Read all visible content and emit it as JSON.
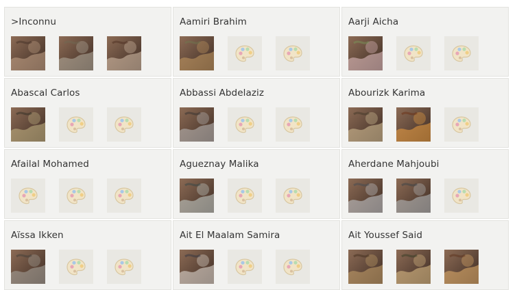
{
  "cards": [
    {
      "name": ">Inconnu",
      "thumbs": [
        {
          "kind": "image",
          "icon": "portrait-painting",
          "colors": [
            "#8c6b55",
            "#c7a58a",
            "#3d2c24"
          ]
        },
        {
          "kind": "image",
          "icon": "flowers-painting",
          "colors": [
            "#3b3a35",
            "#b6b1a3",
            "#6f6a55"
          ]
        },
        {
          "kind": "image",
          "icon": "portrait-painting",
          "colors": [
            "#7c4d32",
            "#d9c3ad",
            "#4a2a1d"
          ]
        }
      ]
    },
    {
      "name": "Aamiri Brahim",
      "thumbs": [
        {
          "kind": "image",
          "icon": "landscape-painting",
          "colors": [
            "#9fb3c7",
            "#c59a62",
            "#6f7b50"
          ]
        },
        {
          "kind": "placeholder",
          "icon": "palette-icon"
        },
        {
          "kind": "placeholder",
          "icon": "palette-icon"
        }
      ]
    },
    {
      "name": "Aarji Aicha",
      "thumbs": [
        {
          "kind": "image",
          "icon": "garden-painting",
          "colors": [
            "#2f5b2e",
            "#e8c4c9",
            "#7a9b5a"
          ]
        },
        {
          "kind": "placeholder",
          "icon": "palette-icon"
        },
        {
          "kind": "placeholder",
          "icon": "palette-icon"
        }
      ]
    },
    {
      "name": "Abascal Carlos",
      "thumbs": [
        {
          "kind": "image",
          "icon": "portrait-painting",
          "colors": [
            "#5c5a48",
            "#c7b887",
            "#2b2b22"
          ]
        },
        {
          "kind": "placeholder",
          "icon": "palette-icon"
        },
        {
          "kind": "placeholder",
          "icon": "palette-icon"
        }
      ]
    },
    {
      "name": "Abbassi Abdelaziz",
      "thumbs": [
        {
          "kind": "image",
          "icon": "abstract-painting",
          "colors": [
            "#6f6f6f",
            "#bdbdbd",
            "#2f2f2f"
          ]
        },
        {
          "kind": "placeholder",
          "icon": "palette-icon"
        },
        {
          "kind": "placeholder",
          "icon": "palette-icon"
        }
      ]
    },
    {
      "name": "Abourizk Karima",
      "thumbs": [
        {
          "kind": "image",
          "icon": "horse-painting",
          "colors": [
            "#7a6a4a",
            "#d8c59b",
            "#3f3525"
          ]
        },
        {
          "kind": "image",
          "icon": "horse-painting",
          "colors": [
            "#c4611e",
            "#f0a341",
            "#6b2d10"
          ]
        },
        {
          "kind": "placeholder",
          "icon": "palette-icon"
        }
      ]
    },
    {
      "name": "Afailal Mohamed",
      "thumbs": [
        {
          "kind": "placeholder",
          "icon": "palette-icon"
        },
        {
          "kind": "placeholder",
          "icon": "palette-icon"
        },
        {
          "kind": "placeholder",
          "icon": "palette-icon"
        }
      ]
    },
    {
      "name": "Agueznay Malika",
      "thumbs": [
        {
          "kind": "image",
          "icon": "calligraphy-painting",
          "colors": [
            "#5f7d7f",
            "#c9d3cf",
            "#2f4446"
          ]
        },
        {
          "kind": "placeholder",
          "icon": "palette-icon"
        },
        {
          "kind": "placeholder",
          "icon": "palette-icon"
        }
      ]
    },
    {
      "name": "Aherdane Mahjoubi",
      "thumbs": [
        {
          "kind": "image",
          "icon": "abstract-painting",
          "colors": [
            "#7c8791",
            "#c9ced3",
            "#3e4a55"
          ]
        },
        {
          "kind": "image",
          "icon": "abstract-painting",
          "colors": [
            "#6e7a80",
            "#b9c1c4",
            "#364047"
          ]
        },
        {
          "kind": "placeholder",
          "icon": "palette-icon"
        }
      ]
    },
    {
      "name": "Aïssa Ikken",
      "thumbs": [
        {
          "kind": "image",
          "icon": "abstract-painting",
          "colors": [
            "#6b6b66",
            "#a9a8a0",
            "#3b3b37"
          ]
        },
        {
          "kind": "placeholder",
          "icon": "palette-icon"
        },
        {
          "kind": "placeholder",
          "icon": "palette-icon"
        }
      ]
    },
    {
      "name": "Ait El Maalam Samira",
      "thumbs": [
        {
          "kind": "image",
          "icon": "abstract-painting",
          "colors": [
            "#4a5f7a",
            "#e7e2da",
            "#2a3140"
          ]
        },
        {
          "kind": "placeholder",
          "icon": "palette-icon"
        },
        {
          "kind": "placeholder",
          "icon": "palette-icon"
        }
      ]
    },
    {
      "name": "Ait Youssef Said",
      "thumbs": [
        {
          "kind": "image",
          "icon": "figures-painting",
          "colors": [
            "#7a5a3a",
            "#c7a26b",
            "#3d2a1a"
          ]
        },
        {
          "kind": "image",
          "icon": "figures-painting",
          "colors": [
            "#6f8f5a",
            "#e2c28a",
            "#2f3a22"
          ]
        },
        {
          "kind": "image",
          "icon": "village-painting",
          "colors": [
            "#b86b3a",
            "#e5b26e",
            "#5a2f18"
          ]
        }
      ]
    }
  ]
}
